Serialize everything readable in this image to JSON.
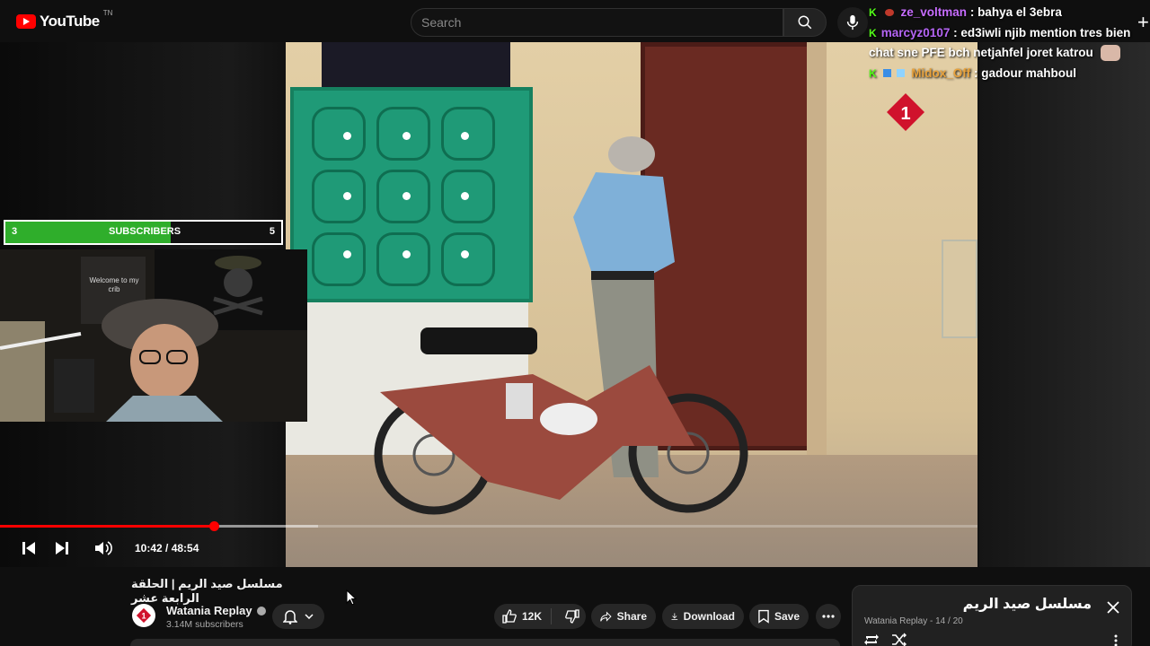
{
  "app": {
    "logo_text": "YouTube",
    "logo_tm": "TN"
  },
  "search": {
    "placeholder": "Search"
  },
  "chat": {
    "messages": [
      {
        "user": "ze_voltman",
        "sep": " : ",
        "text": "bahya el 3ebra"
      },
      {
        "user": "marcyz0107",
        "sep": " : ",
        "text": "ed3iwli njib mention tres bien chat sne PFE bch netjahfel joret katrou"
      },
      {
        "user": "Midox_Off",
        "sep": " : ",
        "text": "gadour mahboul"
      }
    ]
  },
  "subscriber_goal": {
    "current": "3",
    "label": "SUBSCRIBERS",
    "goal": "5",
    "progress_fraction": 0.6
  },
  "webcam": {
    "poster_text": "Welcome to my crib"
  },
  "player": {
    "time_display": "10:42 / 48:54",
    "played_fraction": 0.219,
    "buffered_fraction": 0.325
  },
  "video": {
    "title": "مسلسل صيد الريم | الحلقة الرابعة عشر",
    "channel_name": "Watania Replay",
    "channel_subs": "3.14M subscribers",
    "like_count": "12K",
    "share_label": "Share",
    "download_label": "Download",
    "save_label": "Save"
  },
  "playlist": {
    "title": "مسلسل صيد الريم",
    "meta": "Watania Replay - 14 / 20"
  },
  "colors": {
    "accent_red": "#ff0000",
    "sub_bar_green": "#2fae2b",
    "kick_green": "#53fc18"
  }
}
